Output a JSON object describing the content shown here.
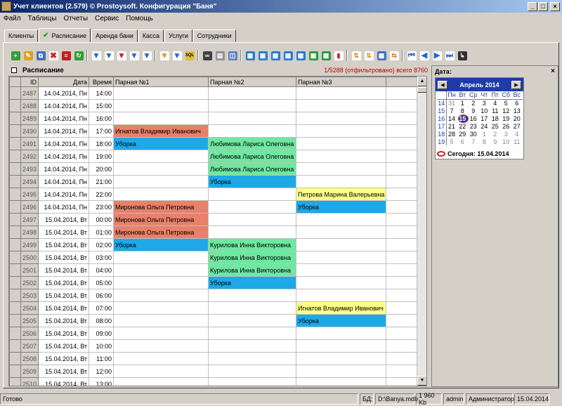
{
  "window": {
    "title": "Учет клиентов (2.579) © Prostoysoft. Конфигурация \"Баня\""
  },
  "menu": [
    "Файл",
    "Таблицы",
    "Отчеты",
    "Сервис",
    "Помощь"
  ],
  "tabs": [
    {
      "label": "Клиенты",
      "active": false
    },
    {
      "label": "Расписание",
      "active": true
    },
    {
      "label": "Аренда бани",
      "active": false
    },
    {
      "label": "Касса",
      "active": false
    },
    {
      "label": "Услуги",
      "active": false
    },
    {
      "label": "Сотрудники",
      "active": false
    }
  ],
  "schedule": {
    "title": "Расписание",
    "count_text": "1/5288 (отфильтровано) всего 8760",
    "columns": [
      "ID",
      "Дата",
      "Время",
      "Парная №1",
      "Парная №2",
      "Парная №3"
    ],
    "rows": [
      {
        "id": "2487",
        "date": "14.04.2014, Пн",
        "time": "14:00",
        "p1": "",
        "p2": "",
        "p3": ""
      },
      {
        "id": "2488",
        "date": "14.04.2014, Пн",
        "time": "15:00",
        "p1": "",
        "p2": "",
        "p3": ""
      },
      {
        "id": "2489",
        "date": "14.04.2014, Пн",
        "time": "16:00",
        "p1": "",
        "p2": "",
        "p3": ""
      },
      {
        "id": "2490",
        "date": "14.04.2014, Пн",
        "time": "17:00",
        "p1": "Игнатов Владимир Иванович",
        "p2": "",
        "p3": ""
      },
      {
        "id": "2491",
        "date": "14.04.2014, Пн",
        "time": "18:00",
        "p1": "Уборка",
        "p2": "Любимова Лариса Олеговна",
        "p3": ""
      },
      {
        "id": "2492",
        "date": "14.04.2014, Пн",
        "time": "19:00",
        "p1": "",
        "p2": "Любимова Лариса Олеговна",
        "p3": ""
      },
      {
        "id": "2493",
        "date": "14.04.2014, Пн",
        "time": "20:00",
        "p1": "",
        "p2": "Любимова Лариса Олеговна",
        "p3": ""
      },
      {
        "id": "2494",
        "date": "14.04.2014, Пн",
        "time": "21:00",
        "p1": "",
        "p2": "Уборка",
        "p3": ""
      },
      {
        "id": "2495",
        "date": "14.04.2014, Пн",
        "time": "22:00",
        "p1": "",
        "p2": "",
        "p3": "Петрова Марина Валерьевна"
      },
      {
        "id": "2496",
        "date": "14.04.2014, Пн",
        "time": "23:00",
        "p1": "Миронова Ольга Петровна",
        "p2": "",
        "p3": "Уборка"
      },
      {
        "id": "2497",
        "date": "15.04.2014, Вт",
        "time": "00:00",
        "p1": "Миронова Ольга Петровна",
        "p2": "",
        "p3": ""
      },
      {
        "id": "2498",
        "date": "15.04.2014, Вт",
        "time": "01:00",
        "p1": "Миронова Ольга Петровна",
        "p2": "",
        "p3": ""
      },
      {
        "id": "2499",
        "date": "15.04.2014, Вт",
        "time": "02:00",
        "p1": "Уборка",
        "p2": "Курилова Инна Викторовна",
        "p3": ""
      },
      {
        "id": "2500",
        "date": "15.04.2014, Вт",
        "time": "03:00",
        "p1": "",
        "p2": "Курилова Инна Викторовна",
        "p3": ""
      },
      {
        "id": "2501",
        "date": "15.04.2014, Вт",
        "time": "04:00",
        "p1": "",
        "p2": "Курилова Инна Викторовна",
        "p3": ""
      },
      {
        "id": "2502",
        "date": "15.04.2014, Вт",
        "time": "05:00",
        "p1": "",
        "p2": "Уборка",
        "p3": ""
      },
      {
        "id": "2503",
        "date": "15.04.2014, Вт",
        "time": "06:00",
        "p1": "",
        "p2": "",
        "p3": ""
      },
      {
        "id": "2504",
        "date": "15.04.2014, Вт",
        "time": "07:00",
        "p1": "",
        "p2": "",
        "p3": "Игнатов Владимир Иванович"
      },
      {
        "id": "2505",
        "date": "15.04.2014, Вт",
        "time": "08:00",
        "p1": "",
        "p2": "",
        "p3": "Уборка"
      },
      {
        "id": "2506",
        "date": "15.04.2014, Вт",
        "time": "09:00",
        "p1": "",
        "p2": "",
        "p3": ""
      },
      {
        "id": "2507",
        "date": "15.04.2014, Вт",
        "time": "10:00",
        "p1": "",
        "p2": "",
        "p3": ""
      },
      {
        "id": "2508",
        "date": "15.04.2014, Вт",
        "time": "11:00",
        "p1": "",
        "p2": "",
        "p3": ""
      },
      {
        "id": "2509",
        "date": "15.04.2014, Вт",
        "time": "12:00",
        "p1": "",
        "p2": "",
        "p3": ""
      },
      {
        "id": "2510",
        "date": "15.04.2014, Вт",
        "time": "13:00",
        "p1": "",
        "p2": "",
        "p3": ""
      }
    ],
    "colors": {
      "cleaning": "#1ea8e8",
      "p1": "#e8806a",
      "p2": "#6ee8a0",
      "p3": "#ffff88"
    }
  },
  "date_panel": {
    "title": "Дата:",
    "calendar": {
      "month": "Апрель 2014",
      "weekdays": [
        "Пн",
        "Вт",
        "Ср",
        "Чт",
        "Пт",
        "Сб",
        "Вс"
      ],
      "weeks": [
        {
          "wk": "14",
          "days": [
            "31",
            "1",
            "2",
            "3",
            "4",
            "5",
            "6"
          ]
        },
        {
          "wk": "15",
          "days": [
            "7",
            "8",
            "9",
            "10",
            "11",
            "12",
            "13"
          ]
        },
        {
          "wk": "16",
          "days": [
            "14",
            "15",
            "16",
            "17",
            "18",
            "19",
            "20"
          ]
        },
        {
          "wk": "17",
          "days": [
            "21",
            "22",
            "23",
            "24",
            "25",
            "26",
            "27"
          ]
        },
        {
          "wk": "18",
          "days": [
            "28",
            "29",
            "30",
            "1",
            "2",
            "3",
            "4"
          ]
        },
        {
          "wk": "19",
          "days": [
            "5",
            "6",
            "7",
            "8",
            "9",
            "10",
            "11"
          ]
        }
      ],
      "today_label": "Сегодня: 15.04.2014",
      "selected_day": "15"
    }
  },
  "status": {
    "ready": "Готово",
    "db_label": "БД:",
    "db_file": "D:\\Banya.mdb",
    "size": "1 960 Kb",
    "user": "admin",
    "role": "Администратор",
    "date": "15.04.2014"
  }
}
